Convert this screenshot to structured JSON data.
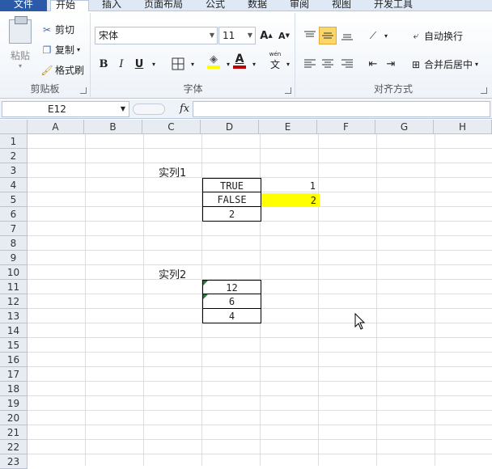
{
  "ribbon": {
    "tabs": [
      "文件",
      "开始",
      "插入",
      "页面布局",
      "公式",
      "数据",
      "审阅",
      "视图",
      "开发工具"
    ],
    "clipboard": {
      "paste": "粘贴",
      "cut": "剪切",
      "copy": "复制",
      "format_painter": "格式刷",
      "label": "剪贴板"
    },
    "font": {
      "name": "宋体",
      "size": "11",
      "bold": "B",
      "italic": "I",
      "underline": "U",
      "label": "字体",
      "wen": "文"
    },
    "alignment": {
      "wrap": "自动换行",
      "merge": "合并后居中",
      "label": "对齐方式"
    }
  },
  "formula_bar": {
    "name_box": "E12",
    "fx": "fx",
    "content": ""
  },
  "columns": [
    "A",
    "B",
    "C",
    "D",
    "E",
    "F",
    "G",
    "H"
  ],
  "rows": [
    "1",
    "2",
    "3",
    "4",
    "5",
    "6",
    "7",
    "8",
    "9",
    "10",
    "11",
    "12",
    "13",
    "14",
    "15",
    "16",
    "17",
    "18",
    "19",
    "20",
    "21",
    "22",
    "23"
  ],
  "sheet": {
    "example1_label": "实列1",
    "example2_label": "实列2",
    "d4": "TRUE",
    "d5": "FALSE",
    "d6": "2",
    "e4": "1",
    "e5": "2",
    "d11": "12",
    "d12": "6",
    "d13": "4"
  },
  "colors": {
    "highlight": "#ffff00",
    "accent": "#2a5aa8"
  }
}
